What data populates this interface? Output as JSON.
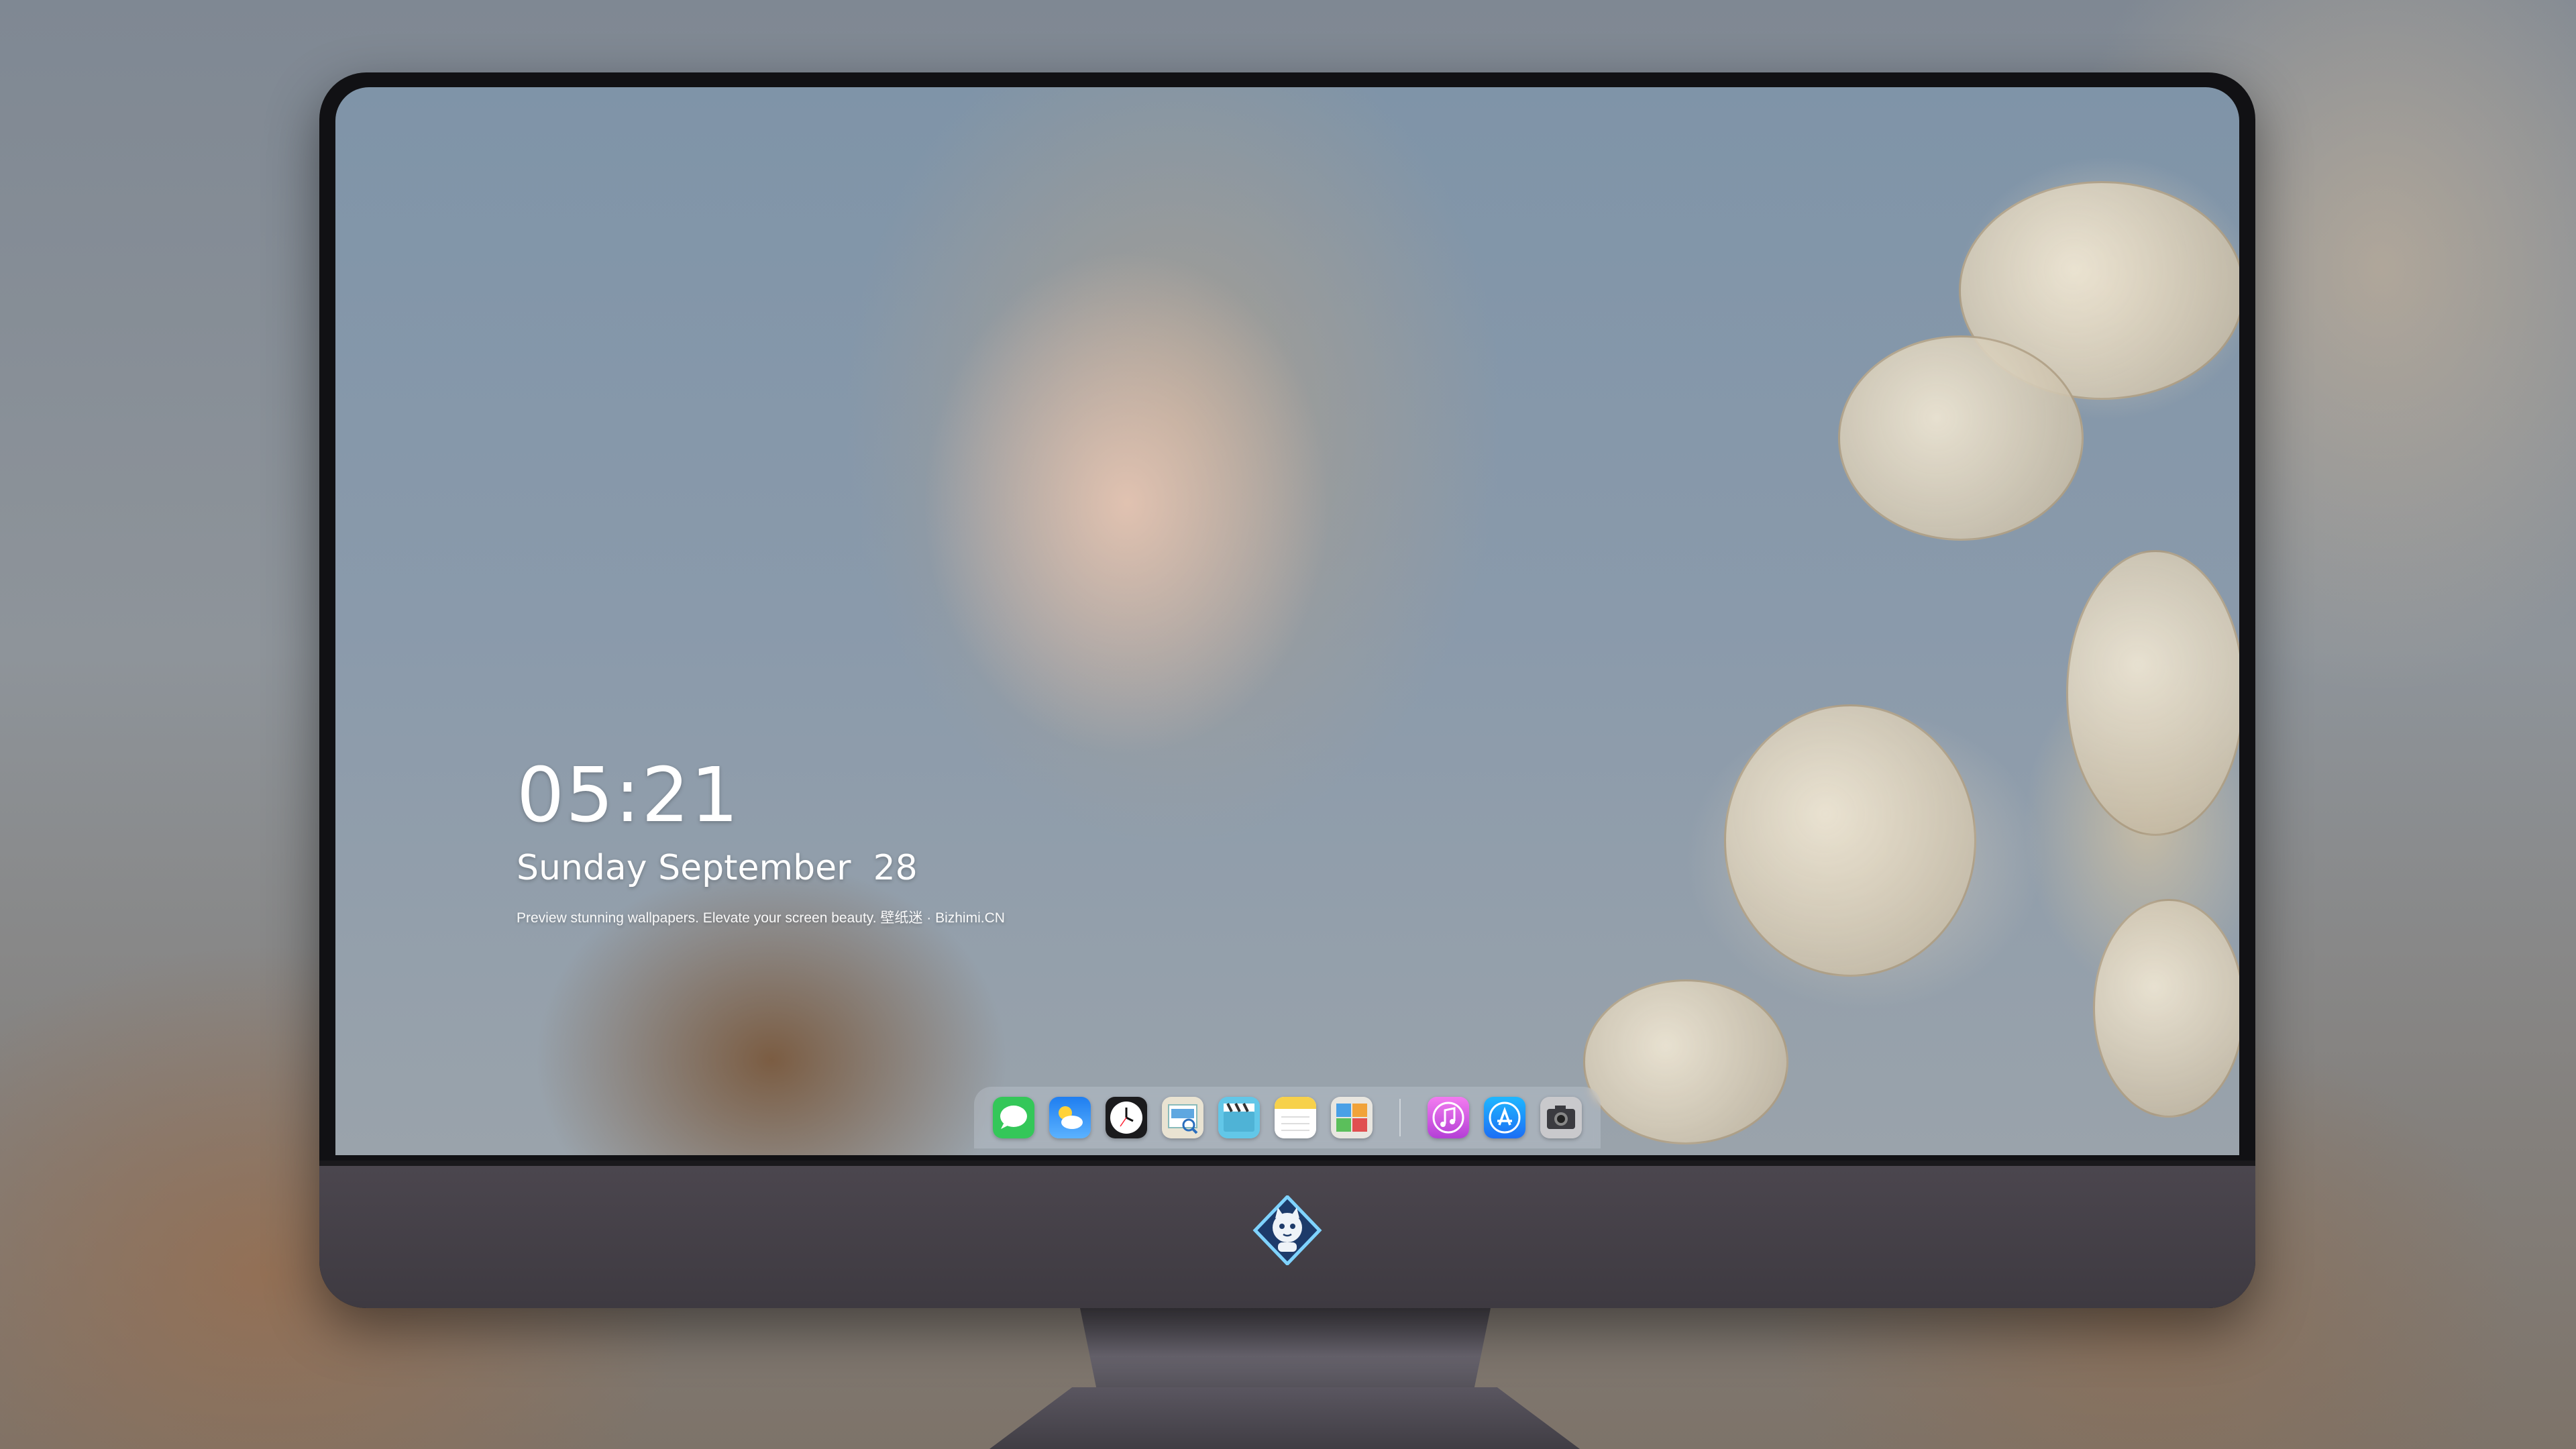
{
  "lockscreen": {
    "time": "05:21",
    "date": "Sunday September  28",
    "tagline": "Preview stunning wallpapers. Elevate your screen beauty. 壁纸迷 · Bizhimi.CN"
  },
  "dock": {
    "apps": [
      {
        "icon": "messages-icon"
      },
      {
        "icon": "weather-icon"
      },
      {
        "icon": "clock-icon"
      },
      {
        "icon": "preview-icon"
      },
      {
        "icon": "clips-icon"
      },
      {
        "icon": "notes-icon"
      },
      {
        "icon": "photo-booth-icon"
      },
      {
        "icon": "music-icon"
      },
      {
        "icon": "app-store-icon"
      },
      {
        "icon": "camera-icon"
      }
    ]
  },
  "monitor": {
    "logo": "mascot-logo-icon"
  },
  "colors": {
    "messages": "#34c759",
    "weather": "#2f8ef0",
    "music": "#d64fd6",
    "app_store": "#1c8ef5",
    "notes": "#f7d14b",
    "chin": "#46414a"
  }
}
